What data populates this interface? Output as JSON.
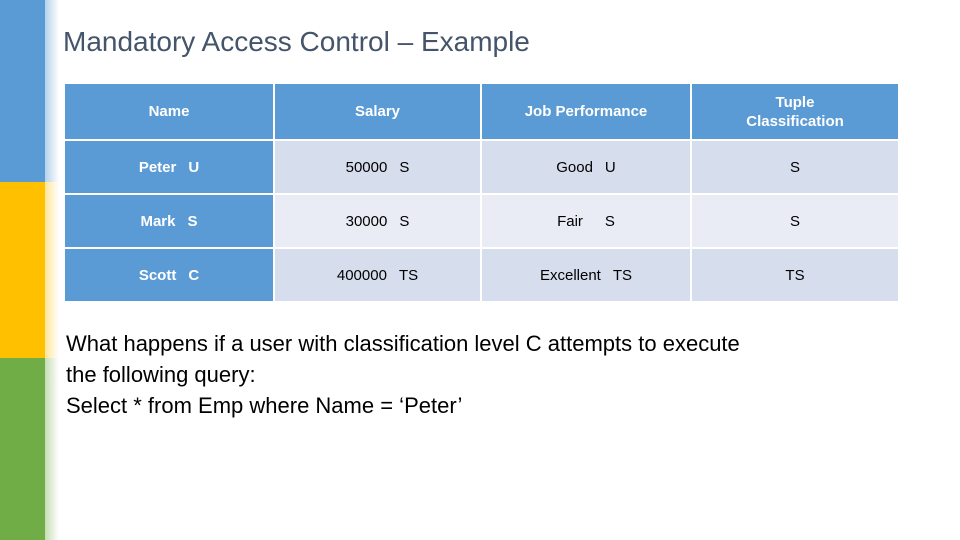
{
  "slide": {
    "title": "Mandatory Access Control – Example",
    "title_color": "#44546a",
    "background": "#ffffff"
  },
  "side_rail": {
    "blocks": [
      {
        "name": "blue",
        "color": "#5b9bd5"
      },
      {
        "name": "yellow",
        "color": "#ffc000"
      },
      {
        "name": "green",
        "color": "#70ad47"
      }
    ]
  },
  "table": {
    "header_bg": "#5b9bd5",
    "header_text_color": "#ffffff",
    "row_band_a": "#d6dded",
    "row_band_b": "#e9ecf5",
    "headers": {
      "name": "Name",
      "salary": "Salary",
      "job_performance": "Job Performance",
      "tuple_classification_line1": "Tuple",
      "tuple_classification_line2": "Classification"
    },
    "rows": [
      {
        "name": "Peter",
        "name_class": "U",
        "salary": "50000",
        "salary_class": "S",
        "performance": "Good",
        "performance_class": "U",
        "tuple_classification": "S"
      },
      {
        "name": "Mark",
        "name_class": "S",
        "salary": "30000",
        "salary_class": "S",
        "performance": "Fair",
        "performance_class": "S",
        "tuple_classification": "S"
      },
      {
        "name": "Scott",
        "name_class": "C",
        "salary": "400000",
        "salary_class": "TS",
        "performance": "Excellent",
        "performance_class": "TS",
        "tuple_classification": "TS"
      }
    ]
  },
  "body": {
    "line1": "What happens if a user with classification level C attempts to execute",
    "line2": "the following query:",
    "line3": "Select * from Emp where Name = ‘Peter’"
  }
}
